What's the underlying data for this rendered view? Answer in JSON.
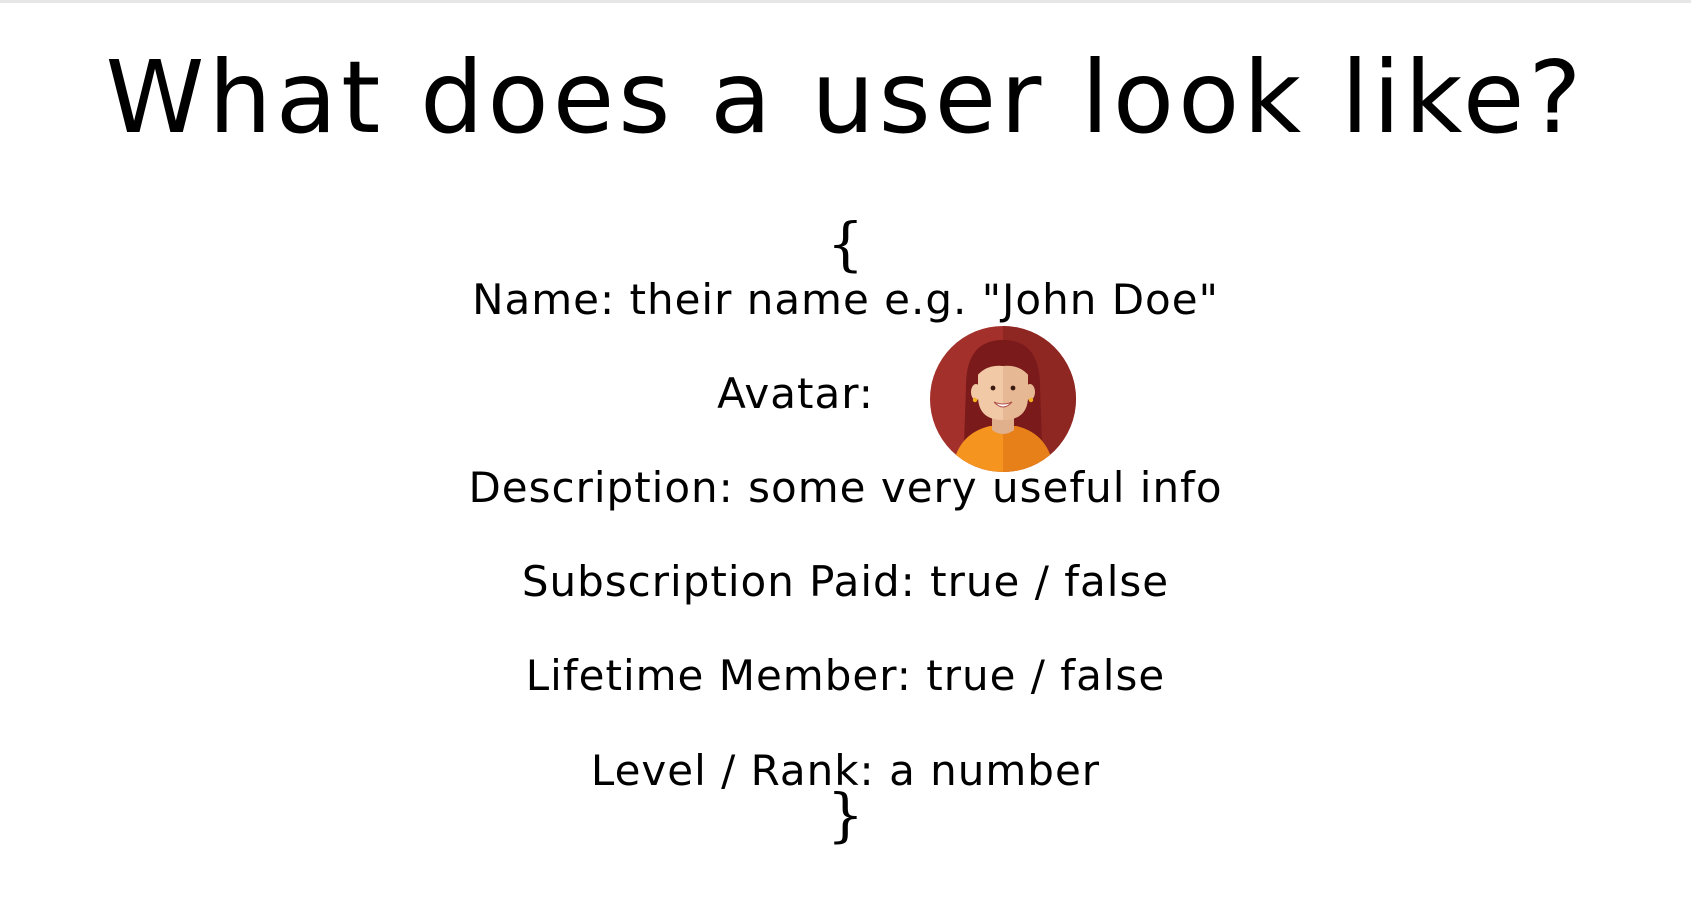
{
  "slide": {
    "title": "What does a user look like?",
    "open_brace": "{",
    "close_brace": "}",
    "fields": {
      "name": "Name: their name e.g. \"John Doe\"",
      "avatar": "Avatar:",
      "description": "Description: some very useful info",
      "subscription": "Subscription Paid: true / false",
      "lifetime": "Lifetime Member: true / false",
      "level": "Level / Rank: a number"
    },
    "avatar_icon": "woman-avatar-icon"
  },
  "colors": {
    "avatar_background": "#a3302a",
    "avatar_background_shade": "#8e2622",
    "hair": "#7a1a1a",
    "skin": "#f2c9a6",
    "shirt": "#f5941f"
  }
}
